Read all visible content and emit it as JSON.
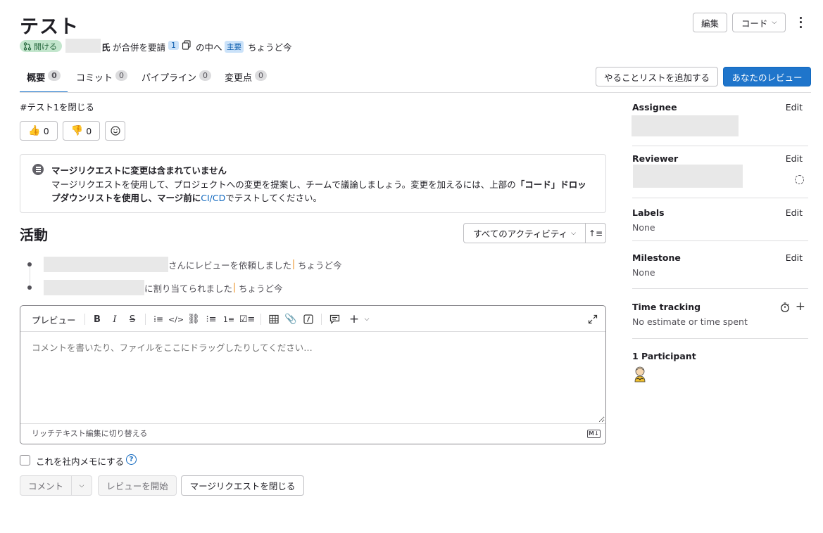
{
  "header": {
    "title": "テスト",
    "status_badge": "開ける",
    "author_suffix": "氏",
    "request_text": "が合併を要請",
    "commit_count": "1",
    "into_text": "の中へ",
    "target_branch": "主要",
    "time": "ちょうど今",
    "edit_button": "編集",
    "code_button": "コード"
  },
  "tabs": [
    {
      "label": "概要",
      "count": "0"
    },
    {
      "label": "コミット",
      "count": "0"
    },
    {
      "label": "パイプライン",
      "count": "0"
    },
    {
      "label": "変更点",
      "count": "0"
    }
  ],
  "actions": {
    "add_todo": "やることリストを追加する",
    "your_review": "あなたのレビュー"
  },
  "description": "#テスト1を閉じる",
  "reactions": {
    "thumbs_up": "0",
    "thumbs_down": "0"
  },
  "notice": {
    "title": "マージリクエストに変更は含まれていません",
    "body_1": "マージリクエストを使用して、プロジェクトへの変更を提案し、チームで議論しましょう。変更を加えるには、上部の",
    "body_bold": "「コード」ドロップダウンリストを使用し、マージ前に",
    "body_link": "CI/CD",
    "body_2": "でテストしてください。"
  },
  "activity": {
    "heading": "活動",
    "filter": "すべてのアクティビティ",
    "items": [
      {
        "text": "さんにレビューを依頼しました",
        "time": "ちょうど今"
      },
      {
        "text": "に割り当てられました",
        "time": "ちょうど今"
      }
    ]
  },
  "editor": {
    "preview": "プレビュー",
    "placeholder": "コメントを書いたり、ファイルをここにドラッグしたりしてください…",
    "switch_rich": "リッチテキスト編集に切り替える",
    "md_badge": "M↓"
  },
  "internal_note": "これを社内メモにする",
  "buttons": {
    "comment": "コメント",
    "start_review": "レビューを開始",
    "close_mr": "マージリクエストを閉じる"
  },
  "sidebar": {
    "assignee": {
      "title": "Assignee",
      "edit": "Edit"
    },
    "reviewer": {
      "title": "Reviewer",
      "edit": "Edit"
    },
    "labels": {
      "title": "Labels",
      "edit": "Edit",
      "value": "None"
    },
    "milestone": {
      "title": "Milestone",
      "edit": "Edit",
      "value": "None"
    },
    "time_tracking": {
      "title": "Time tracking",
      "value": "No estimate or time spent"
    },
    "participants": {
      "title": "1 Participant"
    }
  }
}
